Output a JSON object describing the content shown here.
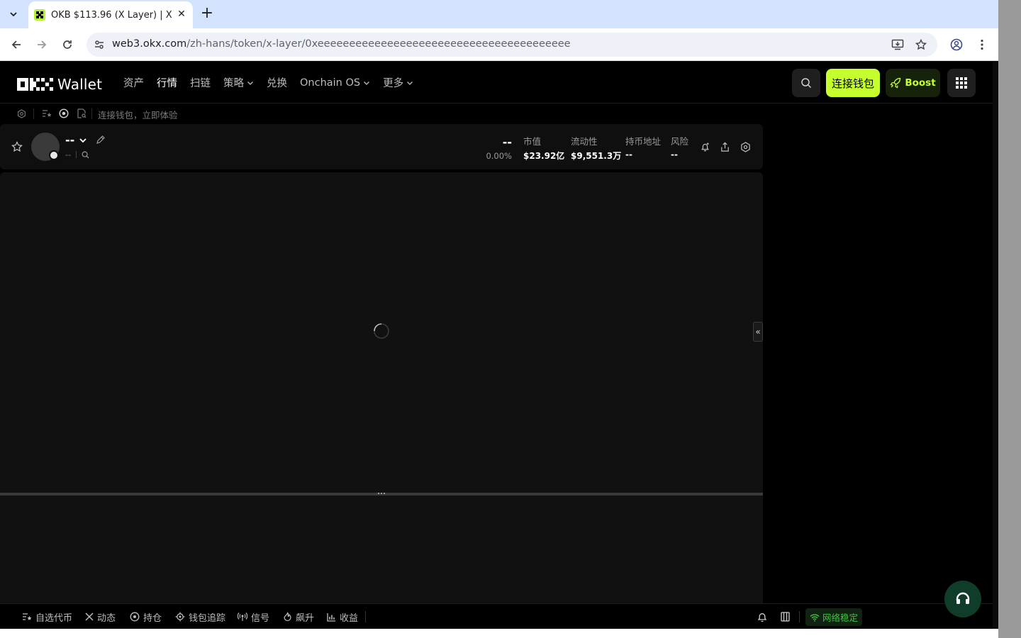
{
  "browser": {
    "tab_title": "OKB $113.96 (X Layer) | X",
    "url_host": "web3.okx.com",
    "url_path": "/zh-hans/token/x-layer/0xeeeeeeeeeeeeeeeeeeeeeeeeeeeeeeeeeeeeeeee"
  },
  "header": {
    "logo_text": "Wallet",
    "nav": [
      {
        "label": "资产"
      },
      {
        "label": "行情",
        "active": true
      },
      {
        "label": "扫链"
      },
      {
        "label": "策略",
        "dropdown": true
      },
      {
        "label": "兑换"
      },
      {
        "label": "Onchain OS",
        "dropdown": true
      },
      {
        "label": "更多",
        "dropdown": true
      }
    ],
    "connect_label": "连接钱包",
    "boost_label": "Boost"
  },
  "subbar": {
    "prompt": "连接钱包，立即体验"
  },
  "token": {
    "name": "--",
    "sub": "--",
    "price": "--",
    "change": "0.00%",
    "stats": [
      {
        "label": "市值",
        "value": "$23.92亿"
      },
      {
        "label": "流动性",
        "value": "$9,551.3万"
      },
      {
        "label": "持币地址",
        "value": "--"
      },
      {
        "label": "风险",
        "value": "--"
      }
    ]
  },
  "chart": {
    "collapse_label": "«"
  },
  "footer": {
    "items": [
      {
        "label": "自选代币",
        "icon": "watchlist-icon"
      },
      {
        "label": "动态",
        "icon": "x-icon"
      },
      {
        "label": "持仓",
        "icon": "holdings-icon"
      },
      {
        "label": "钱包追踪",
        "icon": "tracker-icon"
      },
      {
        "label": "信号",
        "icon": "signal-icon"
      },
      {
        "label": "飙升",
        "icon": "fire-icon"
      },
      {
        "label": "收益",
        "icon": "chart-bar-icon"
      }
    ],
    "network_status": "网络稳定"
  },
  "colors": {
    "accent": "#c6ff2e",
    "page_bg": "#000000",
    "panel_bg": "#111111",
    "success": "#3ec53e"
  }
}
